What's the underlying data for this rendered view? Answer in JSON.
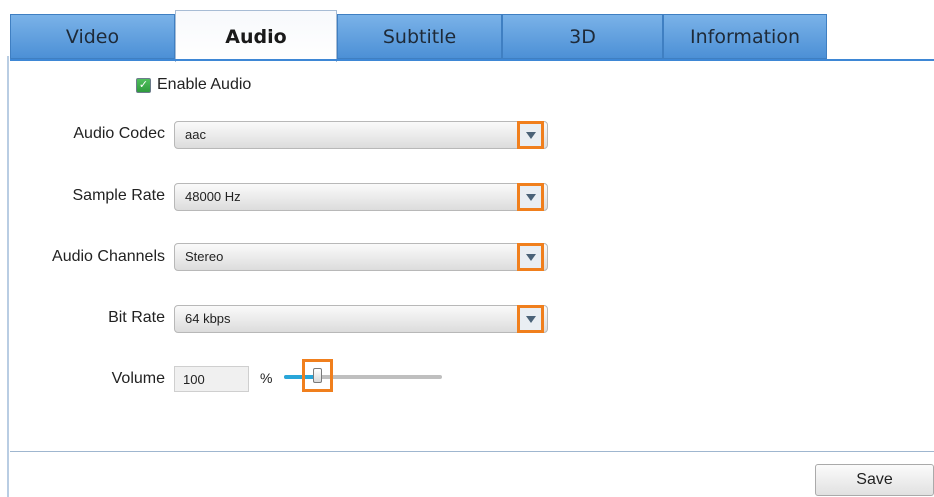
{
  "tabs": [
    {
      "label": "Video",
      "active": false
    },
    {
      "label": "Audio",
      "active": true
    },
    {
      "label": "Subtitle",
      "active": false
    },
    {
      "label": "3D",
      "active": false
    },
    {
      "label": "Information",
      "active": false
    }
  ],
  "enable_audio": {
    "label": "Enable Audio",
    "checked": true
  },
  "audio_codec": {
    "label": "Audio Codec",
    "value": "aac"
  },
  "sample_rate": {
    "label": "Sample Rate",
    "value": "48000 Hz"
  },
  "audio_channels": {
    "label": "Audio Channels",
    "value": "Stereo"
  },
  "bit_rate": {
    "label": "Bit Rate",
    "value": "64 kbps"
  },
  "volume": {
    "label": "Volume",
    "value": "100",
    "unit": "%",
    "slider_level": 0.2
  },
  "save_label": "Save",
  "colors": {
    "accent": "#4c90d6",
    "highlight": "#f07f1d",
    "slider_fill": "#29a6d9"
  }
}
